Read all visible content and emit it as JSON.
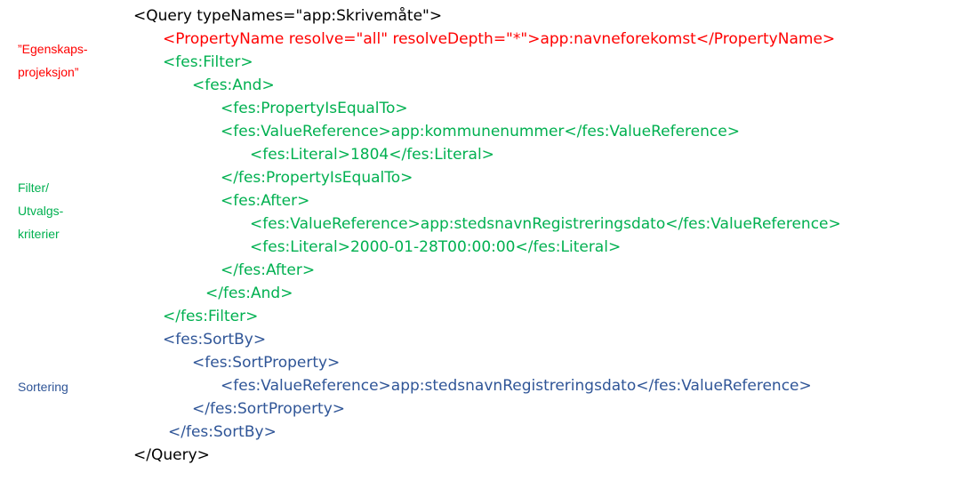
{
  "colors": {
    "black": "#000000",
    "green": "#00b050",
    "red": "#ff0000",
    "blue": "#2f5597"
  },
  "side_labels": [
    {
      "text": "”Egenskaps-\nprojeksjon”",
      "color": "#ff0000"
    },
    {
      "text": "Filter/\nUtvalgs-\nkriterier",
      "color": "#00b050"
    },
    {
      "text": "Sortering",
      "color": "#2f5597"
    }
  ],
  "code_lines": [
    {
      "text": "<Query typeNames=\"app:Skrivemåte\">",
      "color": "#000000"
    },
    {
      "text": "<PropertyName resolve=\"all\" resolveDepth=\"*\">app:navneforekomst</PropertyName>",
      "color": "#ff0000"
    },
    {
      "text": "<fes:Filter>",
      "color": "#00b050"
    },
    {
      "text": "<fes:And>",
      "color": "#00b050"
    },
    {
      "text": "<fes:PropertyIsEqualTo>",
      "color": "#00b050"
    },
    {
      "text": "<fes:ValueReference>app:kommunenummer</fes:ValueReference>",
      "color": "#00b050"
    },
    {
      "text": "<fes:Literal>1804</fes:Literal>",
      "color": "#00b050"
    },
    {
      "text": "</fes:PropertyIsEqualTo>",
      "color": "#00b050"
    },
    {
      "text": "<fes:After>",
      "color": "#00b050"
    },
    {
      "text": "<fes:ValueReference>app:stedsnavnRegistreringsdato</fes:ValueReference>",
      "color": "#00b050"
    },
    {
      "text": "<fes:Literal>2000-01-28T00:00:00</fes:Literal>",
      "color": "#00b050"
    },
    {
      "text": "</fes:After>",
      "color": "#00b050"
    },
    {
      "text": "</fes:And>",
      "color": "#00b050"
    },
    {
      "text": "</fes:Filter>",
      "color": "#00b050"
    },
    {
      "text": "<fes:SortBy>",
      "color": "#2f5597"
    },
    {
      "text": "<fes:SortProperty>",
      "color": "#2f5597"
    },
    {
      "text": "<fes:ValueReference>app:stedsnavnRegistreringsdato</fes:ValueReference>",
      "color": "#2f5597"
    },
    {
      "text": "</fes:SortProperty>",
      "color": "#2f5597"
    },
    {
      "text": "</fes:SortBy>",
      "color": "#2f5597"
    },
    {
      "text": "</Query>",
      "color": "#000000"
    }
  ]
}
